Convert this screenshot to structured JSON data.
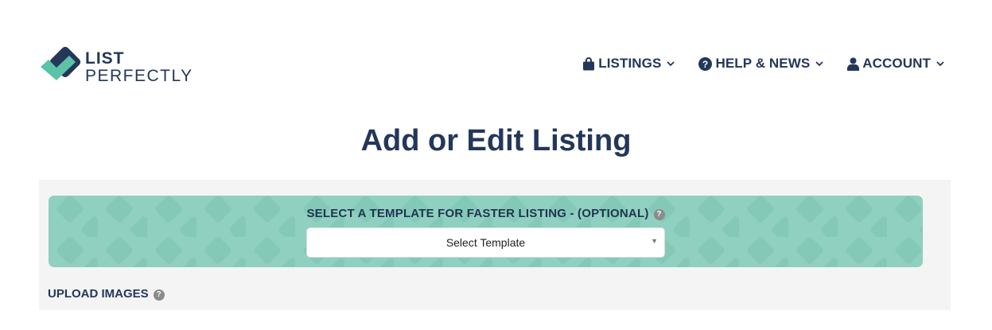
{
  "brand": {
    "line1": "LIST",
    "line2": "PERFECTLY",
    "colors": {
      "navy": "#23375a",
      "teal": "#5cc3a8"
    }
  },
  "nav": {
    "items": [
      {
        "label": "LISTINGS",
        "icon": "shopping-bag-icon"
      },
      {
        "label": "HELP & NEWS",
        "icon": "question-circle-icon"
      },
      {
        "label": "ACCOUNT",
        "icon": "user-icon"
      }
    ]
  },
  "page": {
    "title": "Add or Edit Listing"
  },
  "template": {
    "label": "SELECT A TEMPLATE FOR FASTER LISTING - (OPTIONAL)",
    "help_icon": "?",
    "select_value": "Select Template",
    "caret": "▼",
    "bg_color": "#8fd0c0"
  },
  "upload": {
    "label": "UPLOAD IMAGES",
    "help_icon": "?"
  }
}
